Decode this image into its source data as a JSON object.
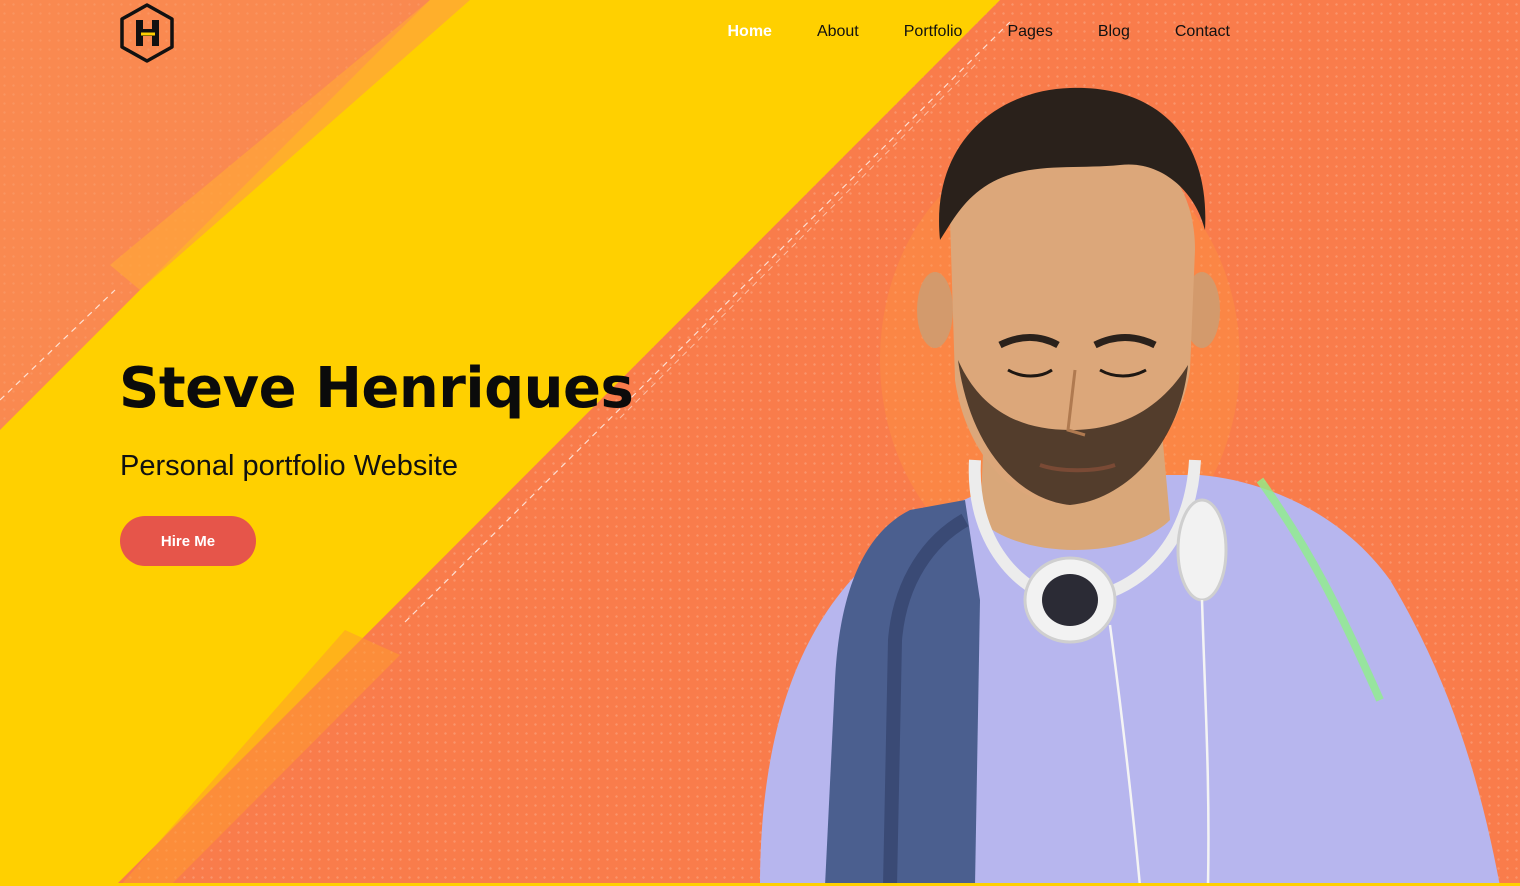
{
  "brand": {
    "logo_icon": "hexagon-h-logo",
    "accent_yellow": "#ffd000",
    "accent_orange": "#f97c4b",
    "button_color": "#e6554a"
  },
  "nav": {
    "items": [
      {
        "label": "Home",
        "active": true
      },
      {
        "label": "About",
        "active": false
      },
      {
        "label": "Portfolio",
        "active": false
      },
      {
        "label": "Pages",
        "active": false
      },
      {
        "label": "Blog",
        "active": false
      },
      {
        "label": "Contact",
        "active": false
      }
    ]
  },
  "hero": {
    "title": "Steve Henriques",
    "subtitle": "Personal portfolio Website",
    "cta_label": "Hire Me"
  }
}
